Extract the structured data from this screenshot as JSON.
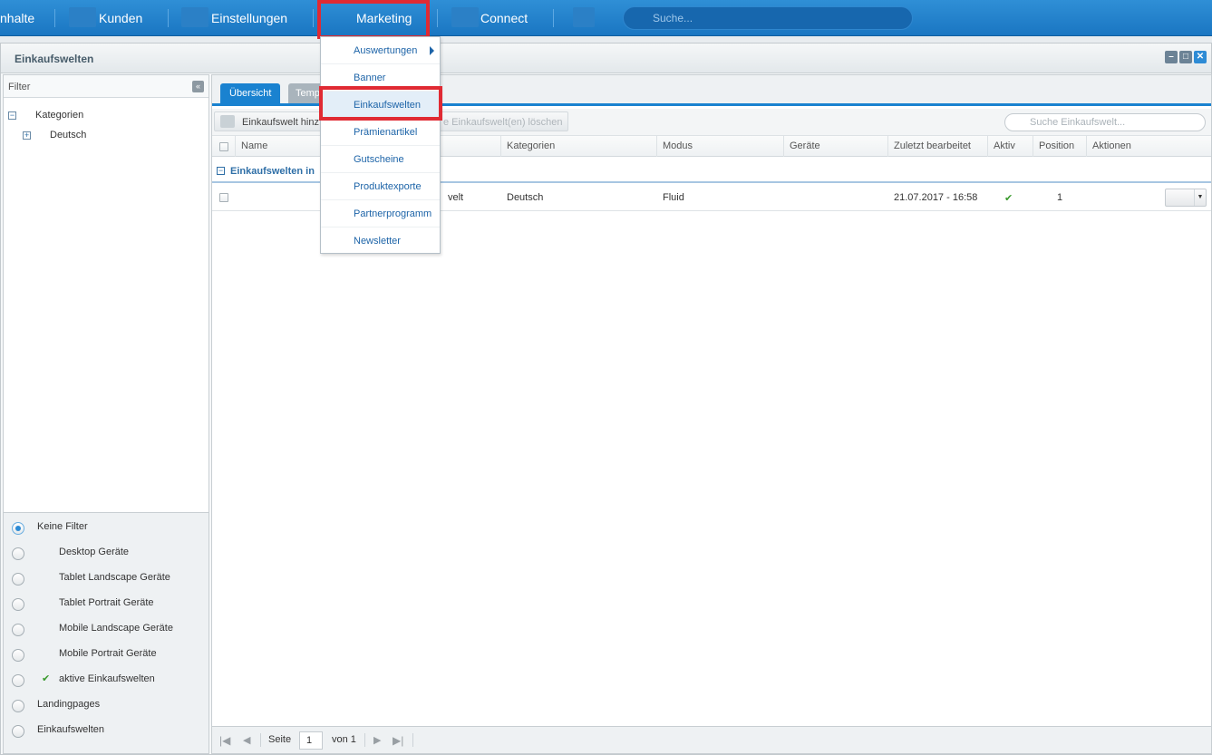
{
  "topnav": {
    "items": [
      {
        "label": "nhalte"
      },
      {
        "label": "Kunden"
      },
      {
        "label": "Einstellungen"
      },
      {
        "label": "Marketing"
      },
      {
        "label": "Connect"
      }
    ],
    "search_placeholder": "Suche..."
  },
  "window": {
    "title": "Einkaufswelten"
  },
  "marketing_menu": {
    "items": [
      {
        "label": "Auswertungen"
      },
      {
        "label": "Banner"
      },
      {
        "label": "Einkaufswelten"
      },
      {
        "label": "Prämienartikel"
      },
      {
        "label": "Gutscheine"
      },
      {
        "label": "Produktexporte"
      },
      {
        "label": "Partnerprogramm"
      },
      {
        "label": "Newsletter"
      }
    ]
  },
  "filter_panel": {
    "title": "Filter",
    "tree": {
      "root": "Kategorien",
      "child": "Deutsch"
    },
    "radio_options": [
      {
        "label": "Keine Filter",
        "selected": true
      },
      {
        "label": "Desktop Geräte"
      },
      {
        "label": "Tablet Landscape Geräte"
      },
      {
        "label": "Tablet Portrait Geräte"
      },
      {
        "label": "Mobile Landscape Geräte"
      },
      {
        "label": "Mobile Portrait Geräte"
      },
      {
        "label": "aktive Einkaufswelten"
      },
      {
        "label": "Landingpages"
      },
      {
        "label": "Einkaufswelten"
      }
    ],
    "check_glyph": "✔"
  },
  "tabs": [
    {
      "label": "Übersicht",
      "active": true
    },
    {
      "label": "Temp"
    }
  ],
  "toolbar": {
    "add_label": "Einkaufswelt hinz",
    "delete_label": "e Einkaufswelt(en) löschen",
    "search_placeholder": "Suche Einkaufswelt..."
  },
  "grid": {
    "columns": [
      "Name",
      "Kategorien",
      "Modus",
      "Geräte",
      "Zuletzt bearbeitet",
      "Aktiv",
      "Position",
      "Aktionen"
    ],
    "group_label": "Einkaufswelten in",
    "rows": [
      {
        "name": "velt",
        "kategorien": "Deutsch",
        "modus": "Fluid",
        "geraete": "",
        "zuletzt": "21.07.2017 - 16:58",
        "aktiv": "✔",
        "position": "1"
      }
    ]
  },
  "pager": {
    "page_label": "Seite",
    "page_value": "1",
    "of_label": "von 1"
  }
}
